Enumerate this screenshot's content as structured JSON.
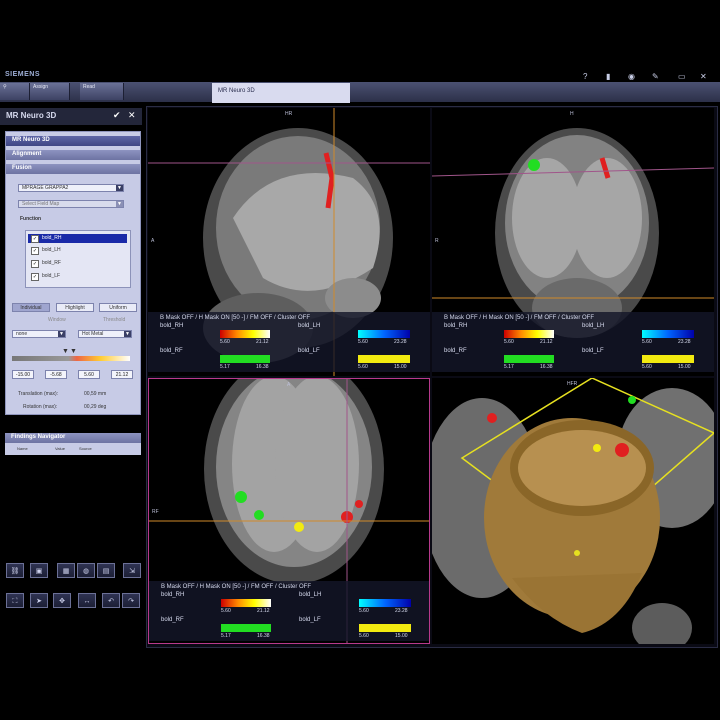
{
  "brand": "SIEMENS",
  "toolbar": {
    "assign_label": "Assign",
    "read_label": "Read",
    "tab_label": "MR Neuro 3D"
  },
  "panel": {
    "title": "MR Neuro 3D",
    "task_header": "MR Neuro 3D",
    "alignment": "Alignment",
    "fusion": "Fusion",
    "series_value": "MPRAGE GRAPPA2",
    "fieldmap_placeholder": "Select Field Map",
    "function_label": "Function",
    "functions": [
      {
        "label": "bold_RH",
        "selected": true
      },
      {
        "label": "bold_LH",
        "selected": false
      },
      {
        "label": "bold_RF",
        "selected": false
      },
      {
        "label": "bold_LF",
        "selected": false
      }
    ],
    "segments": [
      "Individual",
      "Highlight",
      "Uniform"
    ],
    "segments_sub": [
      "Window",
      "Threshold"
    ],
    "lut_left": "none",
    "lut_right": "Hot Metal",
    "range": [
      "-15.00",
      "-5.68",
      "5.60",
      "21.12"
    ],
    "translation_label": "Translation (max):",
    "translation_value": "00,59 mm",
    "rotation_label": "Rotation (max):",
    "rotation_value": "00,29 deg"
  },
  "findings": {
    "title": "Findings Navigator",
    "cols": [
      "Name",
      "Value",
      "Source"
    ]
  },
  "viewports": {
    "sagittal_label": "HR",
    "coronal_label": "H",
    "axial_label": "A",
    "vr_label": "HFR",
    "overlay_title": "B Mask OFF / H Mask ON [50 -] / FM OFF / Cluster OFF",
    "series": [
      {
        "name": "bold_RH",
        "min": "5.60",
        "max": "21.12",
        "color": "hot"
      },
      {
        "name": "bold_LH",
        "min": "5.60",
        "max": "23.28",
        "color": "blue"
      },
      {
        "name": "bold_RF",
        "min": "5.17",
        "max": "16.38",
        "color": "#22dd22"
      },
      {
        "name": "bold_LF",
        "min": "5.60",
        "max": "15.00",
        "color": "#f2ea10"
      }
    ],
    "side_labels": {
      "a": "A",
      "r": "R",
      "rf": "RF"
    }
  },
  "colors": {
    "accent": "#b8398c",
    "panel_bg": "#c7cbe6",
    "crosshair": "#a0558a"
  },
  "icons": [
    "help-icon",
    "trash-icon",
    "record-icon",
    "tool-icon",
    "monitor-icon",
    "close-icon"
  ]
}
